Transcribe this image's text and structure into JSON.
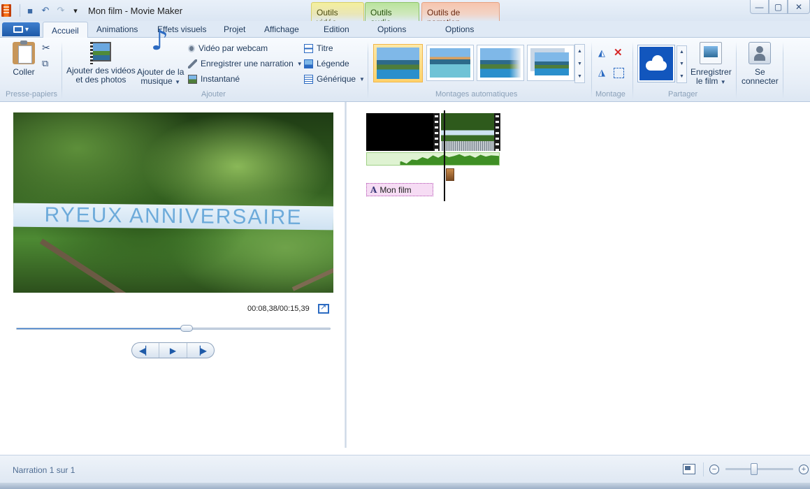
{
  "window": {
    "title": "Mon film - Movie Maker",
    "controls": {
      "minimize": "—",
      "maximize": "▢",
      "close": "✕"
    }
  },
  "quick_access": [
    {
      "name": "save-icon",
      "glyph": "■"
    },
    {
      "name": "undo-icon",
      "glyph": "↶"
    },
    {
      "name": "redo-icon",
      "glyph": "↷"
    },
    {
      "name": "customize-icon",
      "glyph": "▾"
    }
  ],
  "context_tabs": {
    "video": "Outils vidéo",
    "audio": "Outils audio",
    "narration": "Outils de narration"
  },
  "tabs": {
    "file": "▾",
    "accueil": "Accueil",
    "animations": "Animations",
    "effets": "Effets visuels",
    "projet": "Projet",
    "affichage": "Affichage",
    "edition": "Edition",
    "options_audio": "Options",
    "options_narration": "Options"
  },
  "ribbon": {
    "clipboard": {
      "paste": "Coller",
      "group": "Presse-papiers",
      "cut_glyph": "✂",
      "copy_glyph": "⧉"
    },
    "add": {
      "add_videos_line1": "Ajouter des vidéos",
      "add_videos_line2": "et des photos",
      "add_music_line1": "Ajouter de la",
      "add_music_line2": "musique",
      "webcam": "Vidéo par webcam",
      "narration": "Enregistrer une narration",
      "snapshot": "Instantané",
      "title": "Titre",
      "caption": "Légende",
      "credits": "Générique",
      "group": "Ajouter"
    },
    "themes": {
      "group": "Montages automatiques"
    },
    "editing": {
      "group": "Montage"
    },
    "share": {
      "save_line1": "Enregistrer",
      "save_line2": "le film",
      "signin_line1": "Se",
      "signin_line2": "connecter",
      "group": "Partager"
    }
  },
  "preview": {
    "banner_text": "RYEUX ANNIVERSAIRE",
    "time": "00:08,38/00:15,39",
    "seek_fraction": 0.543,
    "transport": {
      "prev": "◀▏",
      "play": "▶",
      "next": "▕▶"
    }
  },
  "storyboard": {
    "caption_clip": "Mon film",
    "caption_glyph": "A"
  },
  "status": {
    "text": "Narration 1 sur 1",
    "zoom_out": "−",
    "zoom_in": "+",
    "zoom_fraction": 0.42
  },
  "colors": {
    "accent": "#1e5aa8",
    "ctx_video": "#f4ef9c",
    "ctx_audio": "#b9e39c",
    "ctx_narration": "#f7c4ad",
    "caption_clip": "#f6dcf4"
  }
}
